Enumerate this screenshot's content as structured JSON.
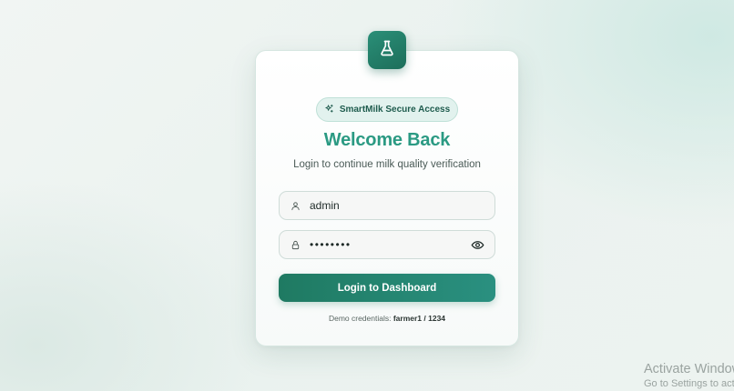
{
  "app": {
    "logo_icon": "flask-icon",
    "badge": {
      "icon": "sparkles-icon",
      "label": "SmartMilk Secure Access"
    },
    "title": "Welcome Back",
    "subtitle": "Login to continue milk quality verification"
  },
  "form": {
    "username": {
      "icon": "user-icon",
      "value": "admin"
    },
    "password": {
      "icon": "lock-icon",
      "value": "••••••••",
      "toggle_icon": "eye-icon"
    },
    "submit_label": "Login to Dashboard"
  },
  "demo": {
    "prefix": "Demo credentials: ",
    "credentials": "farmer1 / 1234"
  },
  "watermark": {
    "line1": "Activate Windows",
    "line2": "Go to Settings to activate Windows."
  },
  "colors": {
    "accent": "#2b9a83",
    "button_start": "#1f7a62",
    "button_end": "#2a9080"
  }
}
